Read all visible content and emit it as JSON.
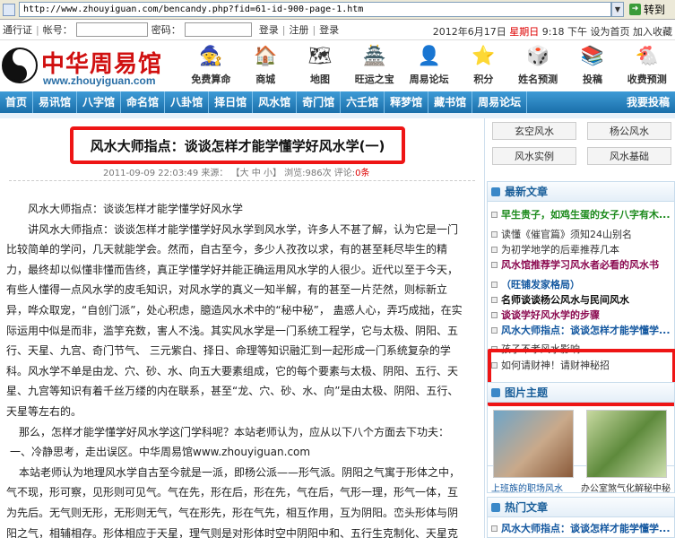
{
  "browser": {
    "url": "http://www.zhouyiguan.com/bencandy.php?fid=61-id-900-page-1.htm",
    "dropdown_glyph": "▼",
    "go_label": "转到"
  },
  "topbar": {
    "pass_label": "通行证",
    "account_label": "帐号：",
    "password_label": "密码：",
    "login_button": "登录",
    "register_link": "注册",
    "signin_link": "登录",
    "date": "2012年6月17日",
    "weekday": "星期日",
    "time": "9:18 下午",
    "homepage_link": "设为首页",
    "favorite_link": "加入收藏"
  },
  "logo": {
    "cn": "中华周易馆",
    "en": "www.zhouyiguan.com"
  },
  "icon_nav": [
    {
      "label": "免费算命",
      "icon": "fortune-icon",
      "glyph": "🧙"
    },
    {
      "label": "商城",
      "icon": "mall-icon",
      "glyph": "🏠"
    },
    {
      "label": "地图",
      "icon": "map-icon",
      "glyph": "🗺"
    },
    {
      "label": "旺运之宝",
      "icon": "treasure-icon",
      "glyph": "🏯"
    },
    {
      "label": "周易论坛",
      "icon": "forum-icon",
      "glyph": "👤"
    },
    {
      "label": "积分",
      "icon": "points-icon",
      "glyph": "⭐"
    },
    {
      "label": "姓名预测",
      "icon": "name-icon",
      "glyph": "🎲"
    },
    {
      "label": "投稿",
      "icon": "submit-icon",
      "glyph": "📚"
    },
    {
      "label": "收费预测",
      "icon": "paid-icon",
      "glyph": "🐔"
    }
  ],
  "menu": [
    "首页",
    "易讯馆",
    "八字馆",
    "命名馆",
    "八卦馆",
    "择日馆",
    "风水馆",
    "奇门馆",
    "六壬馆",
    "释梦馆",
    "藏书馆",
    "周易论坛",
    "我要投稿"
  ],
  "article": {
    "title": "风水大师指点：谈谈怎样才能学懂学好风水学(一)",
    "date": "2011-09-09 22:03:49",
    "author_label": "来源：",
    "size_text": "【大 中 小】",
    "views_text": "浏览:986次",
    "comments_text": "评论:",
    "comments_count": "0条",
    "paragraphs": [
      "风水大师指点：谈谈怎样才能学懂学好风水学",
      "讲风水大师指点：谈谈怎样才能学懂学好风水学到风水学，许多人不甚了解，认为它是一门比较简单的学问，几天就能学会。然而，自古至今，多少人孜孜以求，有的甚至耗尽毕生的精力，最终却以似懂非懂而告终，真正学懂学好并能正确运用风水学的人很少。近代以至于今天，有些人懂得一点风水学的皮毛知识，对风水学的真义一知半解，有的甚至一片茫然，则标新立异，哗众取宠，“自创门派”，处心积虑，臆造风水术中的“秘中秘”， 蛊惑人心，弄巧成拙，在实际运用中似是而非，滥竽充数，害人不浅。其实风水学是一门系统工程学，它与太极、阴阳、五行、天星、九宫、奇门节气、 三元紫白、择日、命理等知识融汇到一起形成一门系统复杂的学科。风水学不单是由龙、穴、砂、水、向五大要素组成，它的每个要素与太极、阴阳、五行、天星、九宫等知识有着千丝万缕的内在联系，甚至“龙、穴、砂、水、向”是由太极、阴阳、五行、天星等左右的。",
      "那么，怎样才能学懂学好风水学这门学科呢？本站老师认为，应从以下八个方面去下功夫：",
      "一、冷静思考，走出误区。中华周易馆www.zhouyiguan.com",
      "本站老师认为地理风水学自古至今就是一派，即杨公派——形气派。阴阳之气寓于形体之中，气不现，形可察，见形则可见气。气在先，形在后，形在先，气在后，气形一理，形气一体，互为先后。无气则无形，无形则无气，气在形先，形在气先，相互作用，互为阴阳。峦头形体与阴阳之气，相辅相存。形体相应于天星，理气则是对形体时空中阴阳中和、五行生克制化、天星克应、九"
    ]
  },
  "sidebar": {
    "tags": [
      "玄空风水",
      "杨公风水",
      "风水实例",
      "风水基础"
    ],
    "latest_title": "最新文章",
    "latest": [
      {
        "text": "早生贵子，如鸡生蛋的女子八字有木...",
        "style": "green"
      },
      {
        "text": "读懂《催官篇》须知24山别名",
        "style": "plain"
      },
      {
        "text": "为初学地学的后辈推荐几本",
        "style": "plain"
      },
      {
        "text": "风水馆推荐学习风水者必看的风水书",
        "style": "purple"
      },
      {
        "text": "（旺铺发家格局）",
        "style": "blue"
      },
      {
        "text": "名师谈谈杨公风水与民间风水",
        "style": "dark"
      },
      {
        "text": "谈谈学好风水学的步骤",
        "style": "purple"
      },
      {
        "text": "风水大师指点：谈谈怎样才能学懂学...",
        "style": "blue"
      },
      {
        "text": "孩子不孝风水影响",
        "style": "plain"
      },
      {
        "text": "如何请财神！请财神秘招",
        "style": "plain"
      }
    ],
    "pics_title": "图片主题",
    "pics": [
      {
        "caption": "上班族的职场风水"
      },
      {
        "caption": "办公室煞气化解秘中秘"
      }
    ],
    "hot_title": "热门文章",
    "hot": [
      {
        "text": "风水大师指点：谈谈怎样才能学懂学...",
        "style": "blue"
      }
    ]
  }
}
